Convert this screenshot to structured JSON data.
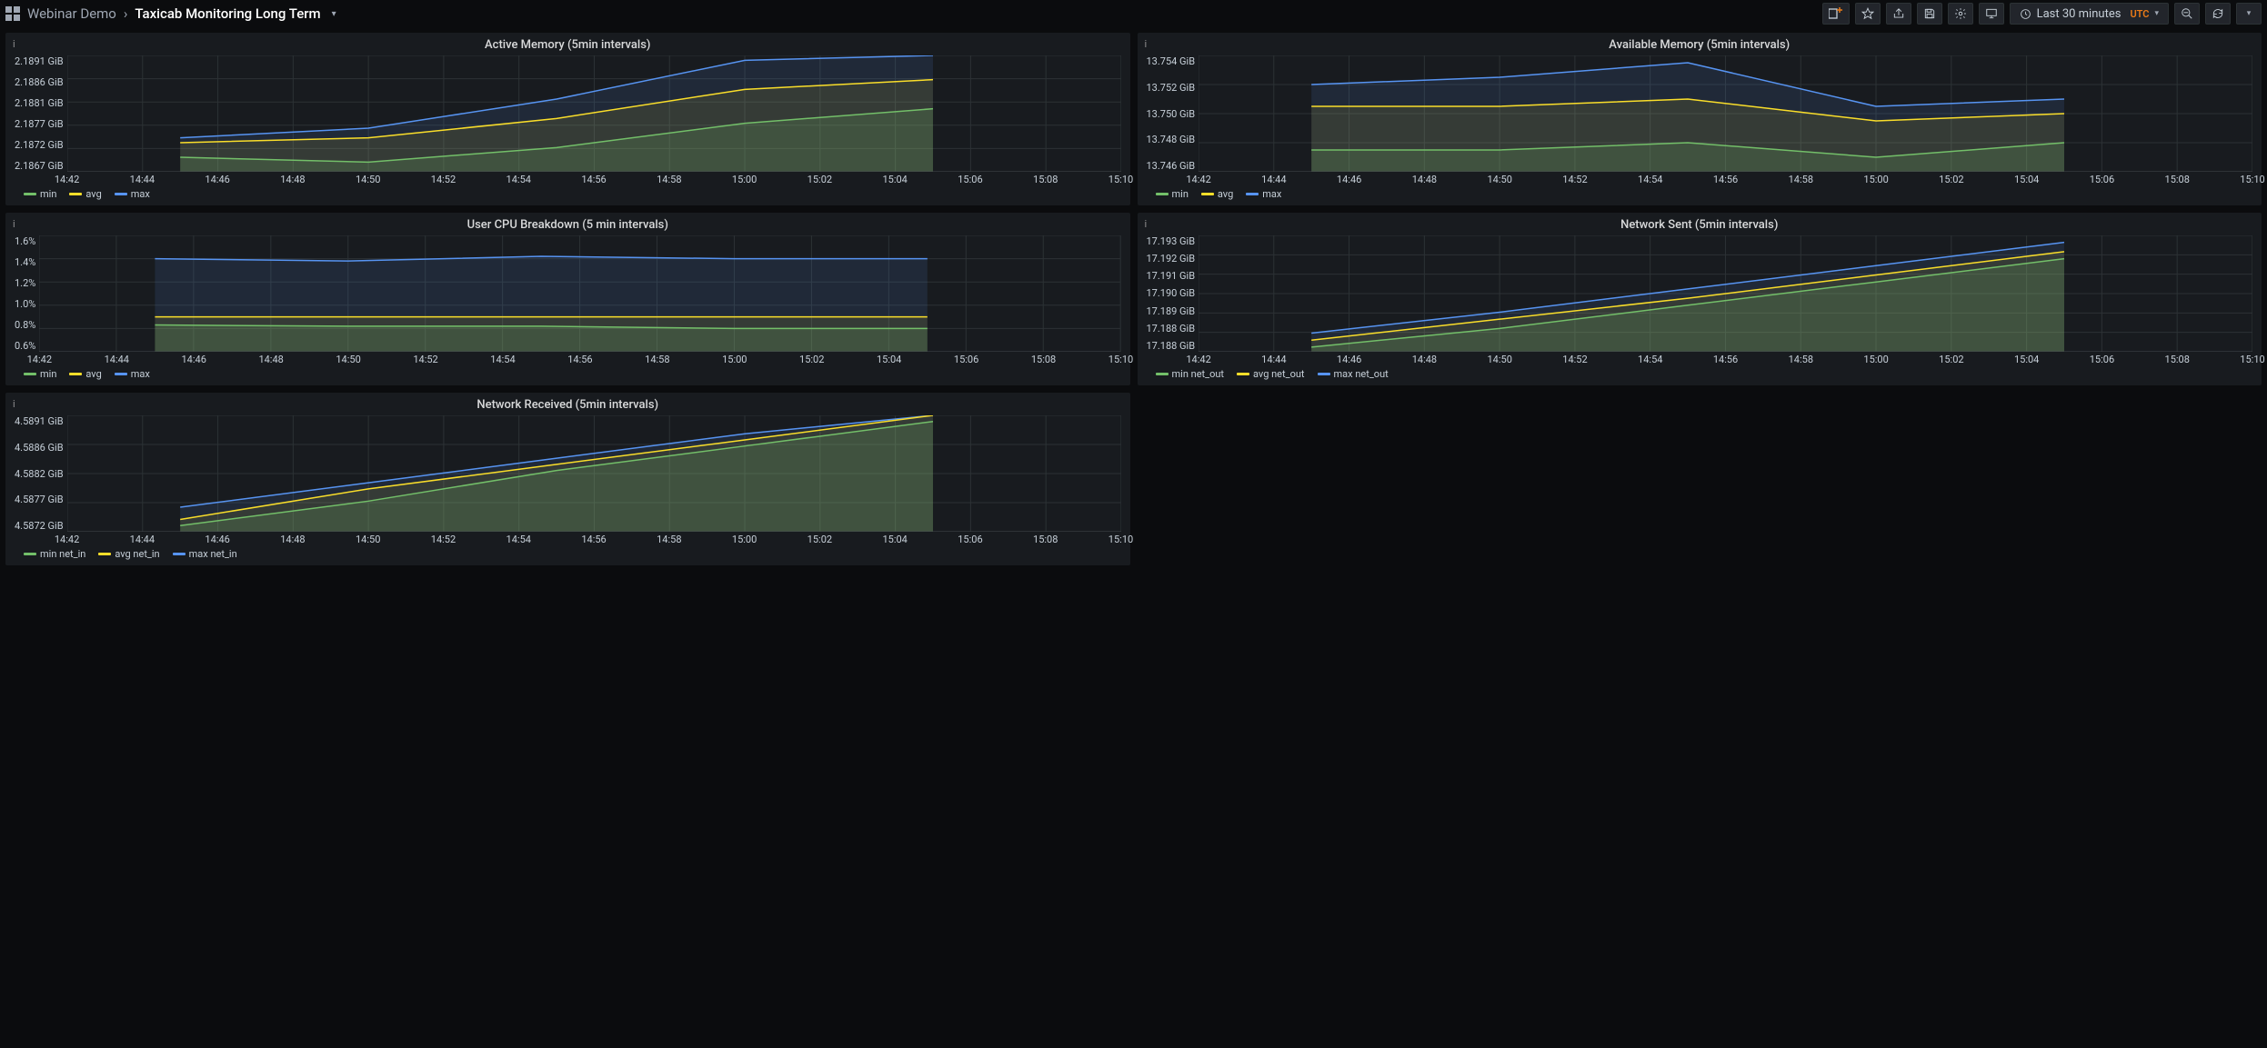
{
  "breadcrumb": {
    "parent": "Webinar Demo",
    "current": "Taxicab Monitoring Long Term"
  },
  "topbar": {
    "time_label": "Last 30 minutes",
    "tz": "UTC"
  },
  "colors": {
    "min": "#73bf69",
    "avg": "#fade2a",
    "max": "#5794f2",
    "grid": "#2c3235",
    "fill_min": "rgba(115,191,105,0.18)",
    "fill_avg": "rgba(250,222,42,0.10)",
    "fill_max": "rgba(87,148,242,0.12)"
  },
  "x_ticks": [
    "14:42",
    "14:44",
    "14:46",
    "14:48",
    "14:50",
    "14:52",
    "14:54",
    "14:56",
    "14:58",
    "15:00",
    "15:02",
    "15:04",
    "15:06",
    "15:08",
    "15:10"
  ],
  "panels": [
    {
      "id": "active-memory",
      "title": "Active Memory (5min intervals)",
      "y_ticks": [
        "2.1891 GiB",
        "2.1886 GiB",
        "2.1881 GiB",
        "2.1877 GiB",
        "2.1872 GiB",
        "2.1867 GiB"
      ],
      "legend": [
        "min",
        "avg",
        "max"
      ]
    },
    {
      "id": "available-memory",
      "title": "Available Memory (5min intervals)",
      "y_ticks": [
        "13.754 GiB",
        "13.752 GiB",
        "13.750 GiB",
        "13.748 GiB",
        "13.746 GiB"
      ],
      "legend": [
        "min",
        "avg",
        "max"
      ]
    },
    {
      "id": "user-cpu",
      "title": "User CPU Breakdown (5 min intervals)",
      "y_ticks": [
        "1.6%",
        "1.4%",
        "1.2%",
        "1.0%",
        "0.8%",
        "0.6%"
      ],
      "legend": [
        "min",
        "avg",
        "max"
      ]
    },
    {
      "id": "network-sent",
      "title": "Network Sent (5min intervals)",
      "y_ticks": [
        "17.193 GiB",
        "17.192 GiB",
        "17.191 GiB",
        "17.190 GiB",
        "17.189 GiB",
        "17.188 GiB",
        "17.188 GiB"
      ],
      "legend": [
        "min net_out",
        "avg net_out",
        "max net_out"
      ]
    },
    {
      "id": "network-received",
      "title": "Network Received (5min intervals)",
      "y_ticks": [
        "4.5891 GiB",
        "4.5886 GiB",
        "4.5882 GiB",
        "4.5877 GiB",
        "4.5872 GiB"
      ],
      "legend": [
        "min net_in",
        "avg net_in",
        "max net_in"
      ]
    }
  ],
  "chart_data": [
    {
      "id": "active-memory",
      "type": "area",
      "title": "Active Memory (5min intervals)",
      "xlabel": "",
      "ylabel": "",
      "x": [
        "14:45",
        "14:50",
        "14:55",
        "15:00",
        "15:05"
      ],
      "ylim": [
        2.1867,
        2.1891
      ],
      "series": [
        {
          "name": "min",
          "values": [
            2.187,
            2.1869,
            2.1872,
            2.1877,
            2.188
          ]
        },
        {
          "name": "avg",
          "values": [
            2.1873,
            2.1874,
            2.1878,
            2.1884,
            2.1886
          ]
        },
        {
          "name": "max",
          "values": [
            2.1874,
            2.1876,
            2.1882,
            2.189,
            2.1891
          ]
        }
      ]
    },
    {
      "id": "available-memory",
      "type": "area",
      "title": "Available Memory (5min intervals)",
      "xlabel": "",
      "ylabel": "",
      "x": [
        "14:45",
        "14:50",
        "14:55",
        "15:00",
        "15:05"
      ],
      "ylim": [
        13.746,
        13.754
      ],
      "series": [
        {
          "name": "min",
          "values": [
            13.7475,
            13.7475,
            13.748,
            13.747,
            13.748
          ]
        },
        {
          "name": "avg",
          "values": [
            13.7505,
            13.7505,
            13.751,
            13.7495,
            13.75
          ]
        },
        {
          "name": "max",
          "values": [
            13.752,
            13.7525,
            13.7535,
            13.7505,
            13.751
          ]
        }
      ]
    },
    {
      "id": "user-cpu",
      "type": "area",
      "title": "User CPU Breakdown (5 min intervals)",
      "xlabel": "",
      "ylabel": "",
      "x": [
        "14:45",
        "14:50",
        "14:55",
        "15:00",
        "15:05"
      ],
      "ylim": [
        0.6,
        1.6
      ],
      "series": [
        {
          "name": "min",
          "values": [
            0.83,
            0.82,
            0.82,
            0.8,
            0.8
          ]
        },
        {
          "name": "avg",
          "values": [
            0.9,
            0.9,
            0.9,
            0.9,
            0.9
          ]
        },
        {
          "name": "max",
          "values": [
            1.4,
            1.38,
            1.42,
            1.4,
            1.4
          ]
        }
      ]
    },
    {
      "id": "network-sent",
      "type": "area",
      "title": "Network Sent (5min intervals)",
      "xlabel": "",
      "ylabel": "",
      "x": [
        "14:45",
        "14:50",
        "14:55",
        "15:00",
        "15:05"
      ],
      "ylim": [
        17.188,
        17.193
      ],
      "series": [
        {
          "name": "min net_out",
          "values": [
            17.1882,
            17.189,
            17.19,
            17.191,
            17.192
          ]
        },
        {
          "name": "avg net_out",
          "values": [
            17.1885,
            17.1894,
            17.1903,
            17.1913,
            17.1923
          ]
        },
        {
          "name": "max net_out",
          "values": [
            17.1888,
            17.1897,
            17.1907,
            17.1917,
            17.1927
          ]
        }
      ]
    },
    {
      "id": "network-received",
      "type": "area",
      "title": "Network Received (5min intervals)",
      "xlabel": "",
      "ylabel": "",
      "x": [
        "14:45",
        "14:50",
        "14:55",
        "15:00",
        "15:05"
      ],
      "ylim": [
        4.5872,
        4.5891
      ],
      "series": [
        {
          "name": "min net_in",
          "values": [
            4.5873,
            4.5877,
            4.5882,
            4.5886,
            4.589
          ]
        },
        {
          "name": "avg net_in",
          "values": [
            4.5874,
            4.5879,
            4.5883,
            4.5887,
            4.5891
          ]
        },
        {
          "name": "max net_in",
          "values": [
            4.5876,
            4.588,
            4.5884,
            4.5888,
            4.5891
          ]
        }
      ]
    }
  ]
}
